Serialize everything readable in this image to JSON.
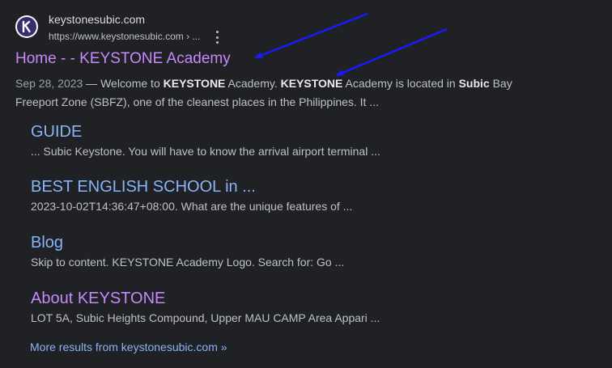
{
  "site": {
    "name": "keystonesubic.com",
    "url": "https://www.keystonesubic.com › ...",
    "favicon_icon": "keystone-logo-icon",
    "favicon_letter": "K"
  },
  "result": {
    "title": "Home - - KEYSTONE Academy",
    "date": "Sep 28, 2023",
    "snippet_parts": [
      " — Welcome to ",
      "KEYSTONE",
      " Academy. ",
      "KEYSTONE",
      " Academy is located in ",
      "Subic",
      " Bay Freeport Zone (SBFZ), one of the cleanest places in the Philippines. It ..."
    ]
  },
  "sublinks": [
    {
      "title": "GUIDE",
      "desc": "... Subic Keystone. You will have to know the arrival airport terminal ...",
      "visited": false
    },
    {
      "title": "BEST ENGLISH SCHOOL in ...",
      "desc": "2023-10-02T14:36:47+08:00. What are the unique features of ...",
      "visited": false
    },
    {
      "title": "Blog",
      "desc": "Skip to content. KEYSTONE Academy Logo. Search for: Go ...",
      "visited": false
    },
    {
      "title": "About KEYSTONE",
      "desc": "LOT 5A, Subic Heights Compound, Upper MAU CAMP Area Appari ...",
      "visited": true
    }
  ],
  "more_results": "More results from keystonesubic.com »",
  "colors": {
    "background": "#202124",
    "link": "#8ab4f8",
    "visited_link": "#c58af9",
    "annotation_arrow": "#1a1aff"
  },
  "annotations": {
    "arrow_icon": "arrow-annotation-icon",
    "count": 2
  }
}
